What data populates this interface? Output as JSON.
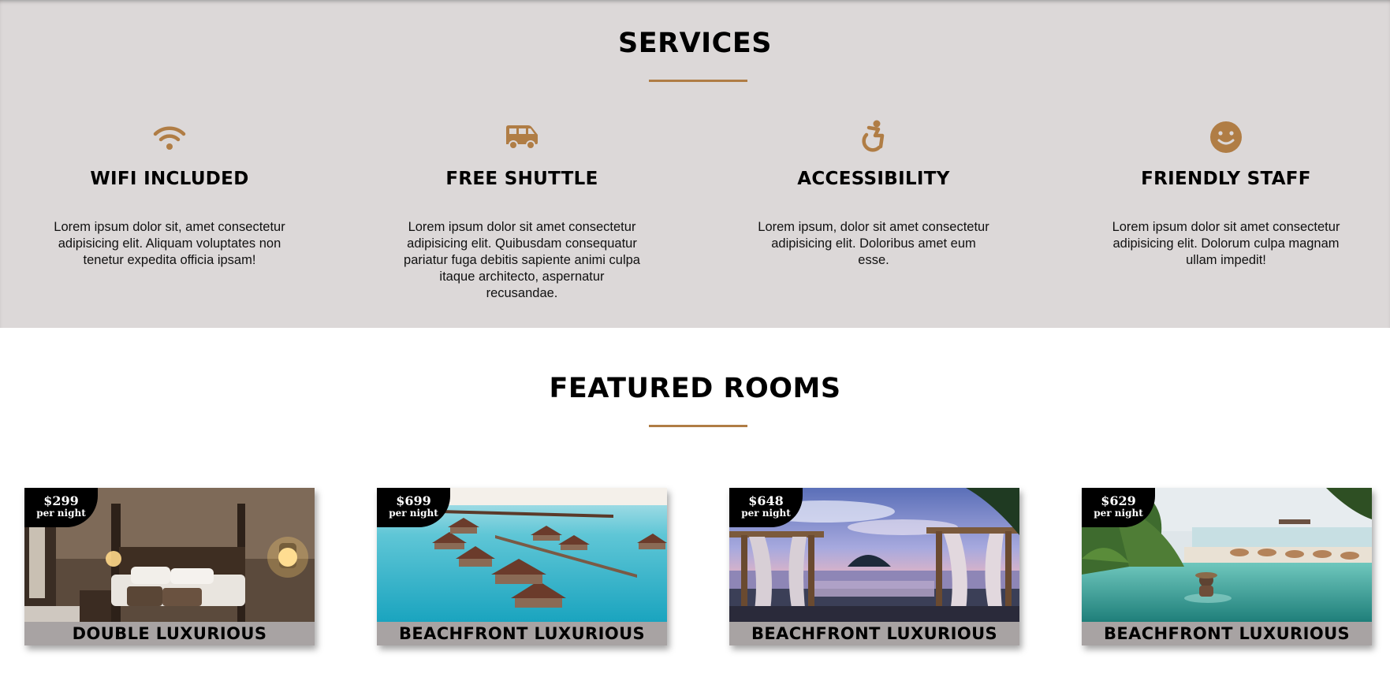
{
  "services": {
    "title": "SERVICES",
    "items": [
      {
        "icon": "wifi-icon",
        "title": "WIFI INCLUDED",
        "text": "Lorem ipsum dolor sit, amet consectetur adipisicing elit. Aliquam voluptates non tenetur expedita officia ipsam!"
      },
      {
        "icon": "shuttle-van-icon",
        "title": "FREE SHUTTLE",
        "text": "Lorem ipsum dolor sit amet consectetur adipisicing elit. Quibusdam consequatur pariatur fuga debitis sapiente animi culpa itaque architecto, aspernatur recusandae."
      },
      {
        "icon": "accessibility-icon",
        "title": "ACCESSIBILITY",
        "text": "Lorem ipsum, dolor sit amet consectetur adipisicing elit. Doloribus amet eum esse."
      },
      {
        "icon": "smiley-face-icon",
        "title": "FRIENDLY STAFF",
        "text": "Lorem ipsum dolor sit amet consectetur adipisicing elit. Dolorum culpa magnam ullam impedit!"
      }
    ]
  },
  "featured": {
    "title": "FEATURED ROOMS",
    "rooms": [
      {
        "price": "$299",
        "unit": "per night",
        "name": "DOUBLE LUXURIOUS"
      },
      {
        "price": "$699",
        "unit": "per night",
        "name": "BEACHFRONT LUXURIOUS"
      },
      {
        "price": "$648",
        "unit": "per night",
        "name": "BEACHFRONT LUXURIOUS"
      },
      {
        "price": "$629",
        "unit": "per night",
        "name": "BEACHFRONT LUXURIOUS"
      }
    ]
  },
  "colors": {
    "accent": "#b07d45",
    "services_background": "#dcd8d8",
    "room_label_background": "#a8a3a3",
    "price_badge": "#000000"
  }
}
